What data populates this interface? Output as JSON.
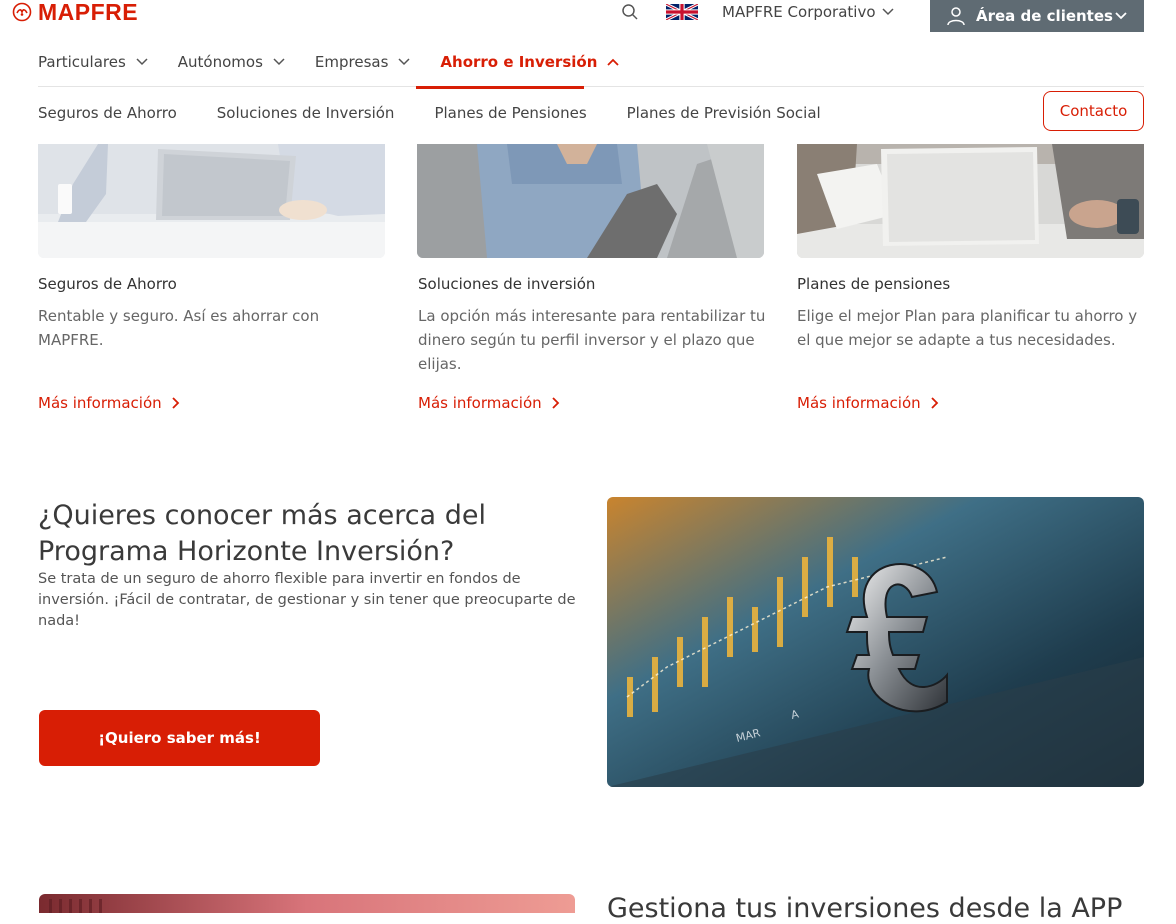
{
  "brand": {
    "name": "MAPFRE",
    "color": "#d81e05"
  },
  "header": {
    "search_icon": "search-icon",
    "language_flag": "uk-flag-icon",
    "corporate_label": "MAPFRE Corporativo",
    "client_area_label": "Área de clientes"
  },
  "main_nav": [
    {
      "label": "Particulares",
      "active": false
    },
    {
      "label": "Autónomos",
      "active": false
    },
    {
      "label": "Empresas",
      "active": false
    },
    {
      "label": "Ahorro e Inversión",
      "active": true
    }
  ],
  "sub_nav": [
    "Seguros de Ahorro",
    "Soluciones de Inversión",
    "Planes de Pensiones",
    "Planes de Previsión Social"
  ],
  "contact_label": "Contacto",
  "cards": [
    {
      "title": "Seguros de Ahorro",
      "description": "Rentable y seguro. Así es ahorrar con MAPFRE.",
      "link": "Más información"
    },
    {
      "title": "Soluciones de inversión",
      "description": "La opción más interesante para rentabilizar tu dinero según tu perfil inversor y el plazo que elijas.",
      "link": "Más información"
    },
    {
      "title": "Planes de pensiones",
      "description": "Elige el mejor Plan para planificar tu ahorro y el que mejor se adapte a tus necesidades.",
      "link": "Más información"
    }
  ],
  "promo": {
    "title": "¿Quieres conocer más acerca del Programa Horizonte Inversión?",
    "text": "Se trata de un seguro de ahorro flexible para invertir en fondos de inversión. ¡Fácil de contratar, de gestionar y sin tener que preocuparte de nada!",
    "button": "¡Quiero saber más!"
  },
  "bottom": {
    "title": "Gestiona tus inversiones desde la APP"
  }
}
